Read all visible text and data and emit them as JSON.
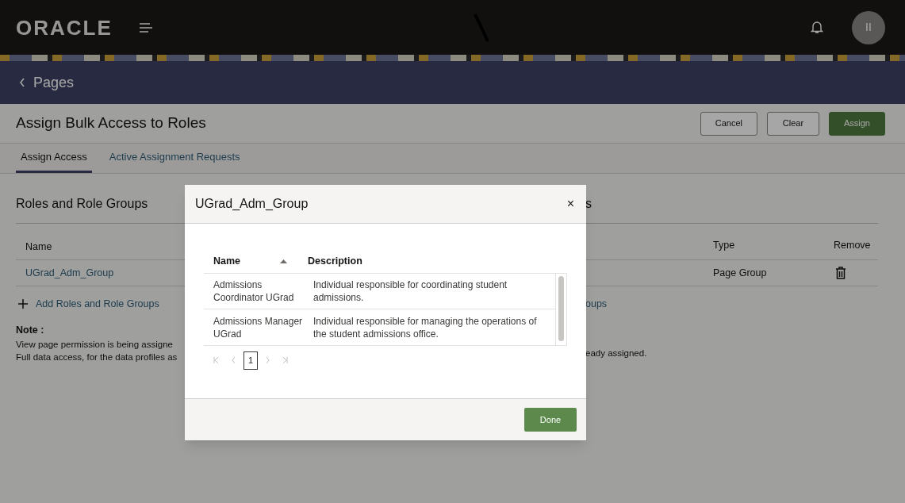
{
  "header": {
    "logo": "ORACLE",
    "avatar": "II"
  },
  "banner": {
    "back_label": "Pages"
  },
  "page": {
    "title": "Assign Bulk Access to Roles",
    "buttons": [
      {
        "label": "Cancel",
        "kind": "secondary"
      },
      {
        "label": "Clear",
        "kind": "secondary"
      },
      {
        "label": "Assign",
        "kind": "primary"
      }
    ]
  },
  "tabs": [
    {
      "label": "Assign Access",
      "selected": true
    },
    {
      "label": "Active Assignment Requests",
      "selected": false
    }
  ],
  "left_panel": {
    "heading": "Roles and Role Groups",
    "column": "Name",
    "row": "UGrad_Adm_Group",
    "add_link": "Add Roles and Role Groups"
  },
  "note": {
    "title": "Note :",
    "lines": [
      "View page permission is being assigne",
      "Full data access, for the data profiles as"
    ]
  },
  "right_panel": {
    "heading": "s",
    "columns": [
      "Type",
      "Remove"
    ],
    "row_type": "Page Group",
    "add_link": "oups",
    "note_line": "eady assigned."
  },
  "dialog": {
    "title": "UGrad_Adm_Group",
    "close": "×",
    "columns": [
      "Name",
      "Description"
    ],
    "rows": [
      {
        "name": "Admissions Coordinator UGrad",
        "description": "Individual responsible for coordinating student admissions."
      },
      {
        "name": "Admissions Manager UGrad",
        "description": "Individual responsible for managing the operations of the student admissions office."
      }
    ],
    "pages": [
      {
        "label": "1",
        "selected": true
      }
    ],
    "done": "Done"
  }
}
